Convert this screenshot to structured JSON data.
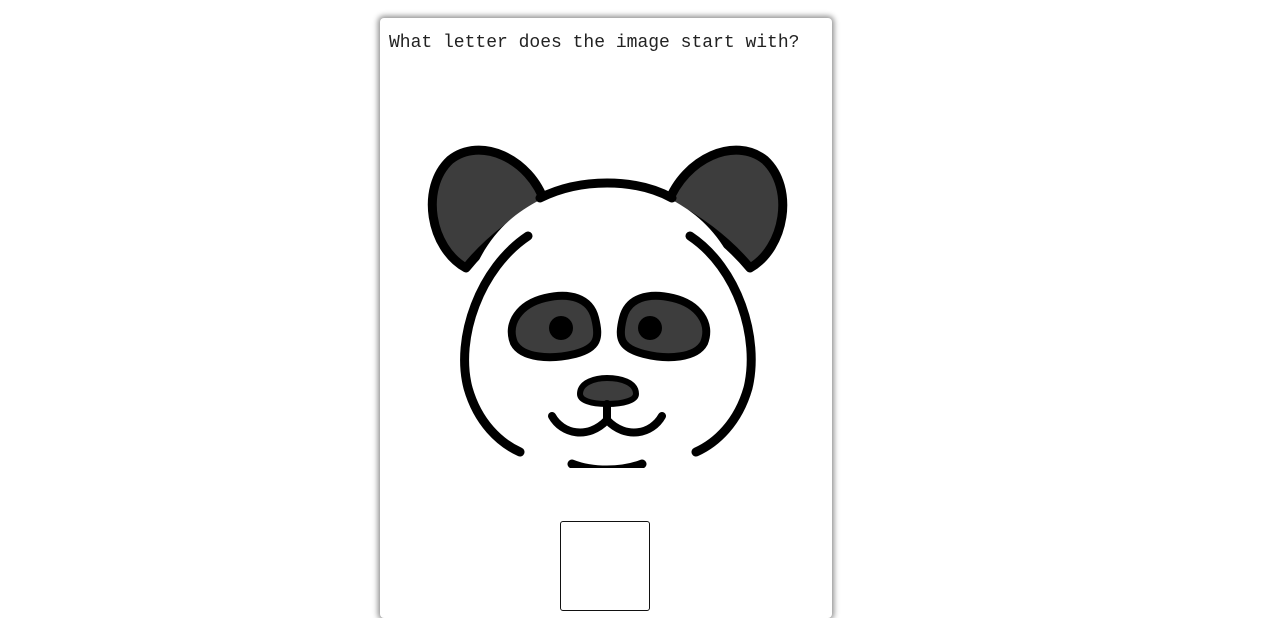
{
  "question": {
    "text": "What letter does the image start with?"
  },
  "image": {
    "icon": "panda-icon",
    "colors": {
      "outline": "#000000",
      "patch": "#3d3d3d",
      "face": "#ffffff"
    }
  },
  "answer": {
    "value": ""
  }
}
